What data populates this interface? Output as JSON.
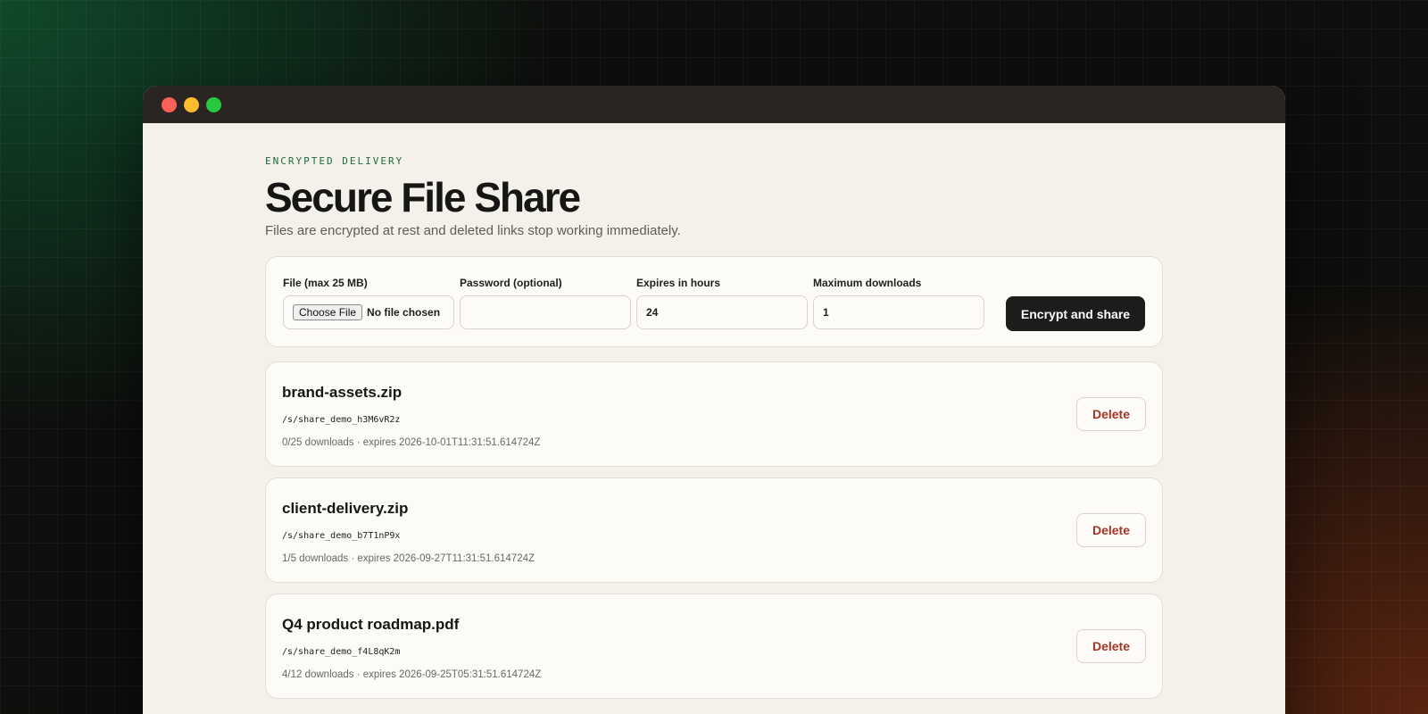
{
  "header": {
    "eyebrow": "ENCRYPTED DELIVERY",
    "title": "Secure File Share",
    "subtitle": "Files are encrypted at rest and deleted links stop working immediately."
  },
  "form": {
    "file_label": "File (max 25 MB)",
    "file_button": "Choose File",
    "file_status": "No file chosen",
    "password_label": "Password (optional)",
    "password_value": "",
    "expires_label": "Expires in hours",
    "expires_value": "24",
    "max_downloads_label": "Maximum downloads",
    "max_downloads_value": "1",
    "submit_label": "Encrypt and share"
  },
  "files": [
    {
      "name": "brand-assets.zip",
      "link": "/s/share_demo_h3M6vR2z",
      "meta": "0/25 downloads · expires 2026-10-01T11:31:51.614724Z",
      "delete_label": "Delete"
    },
    {
      "name": "client-delivery.zip",
      "link": "/s/share_demo_b7T1nP9x",
      "meta": "1/5 downloads · expires 2026-09-27T11:31:51.614724Z",
      "delete_label": "Delete"
    },
    {
      "name": "Q4 product roadmap.pdf",
      "link": "/s/share_demo_f4L8qK2m",
      "meta": "4/12 downloads · expires 2026-09-25T05:31:51.614724Z",
      "delete_label": "Delete"
    }
  ],
  "colors": {
    "accent_green": "#1f6b3d",
    "delete_red": "#a33526",
    "primary_button": "#1b1d1a"
  }
}
